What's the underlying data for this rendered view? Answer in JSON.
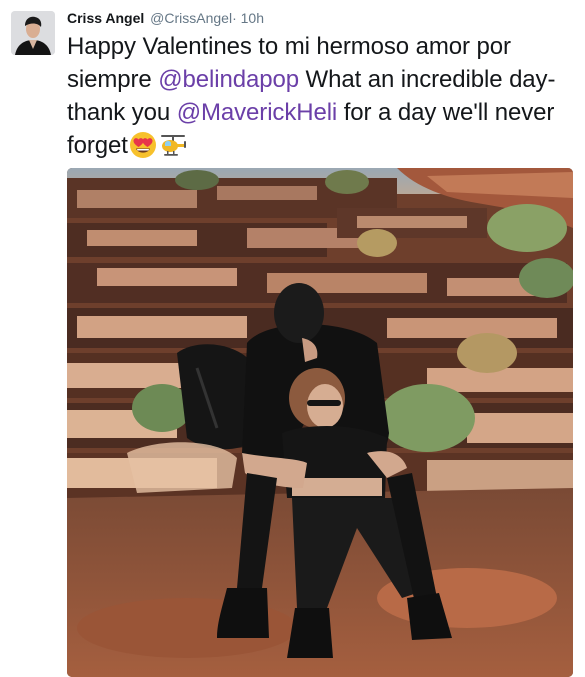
{
  "author": {
    "name": "Criss Angel",
    "handle": "@CrissAngel",
    "separator": "·",
    "time": "10h"
  },
  "tweet": {
    "text_1": "Happy Valentines to mi hermoso amor por siempre ",
    "mention_1": "@belindapop",
    "text_2": " What an incredible day-thank you ",
    "mention_2": "@MaverickHeli",
    "text_3": " for a day we'll never forget",
    "emojis": [
      "heart-eyes-face-icon",
      "helicopter-icon"
    ]
  },
  "colors": {
    "name": "#14171a",
    "meta": "#657786",
    "mention": "#6b3fa8"
  }
}
